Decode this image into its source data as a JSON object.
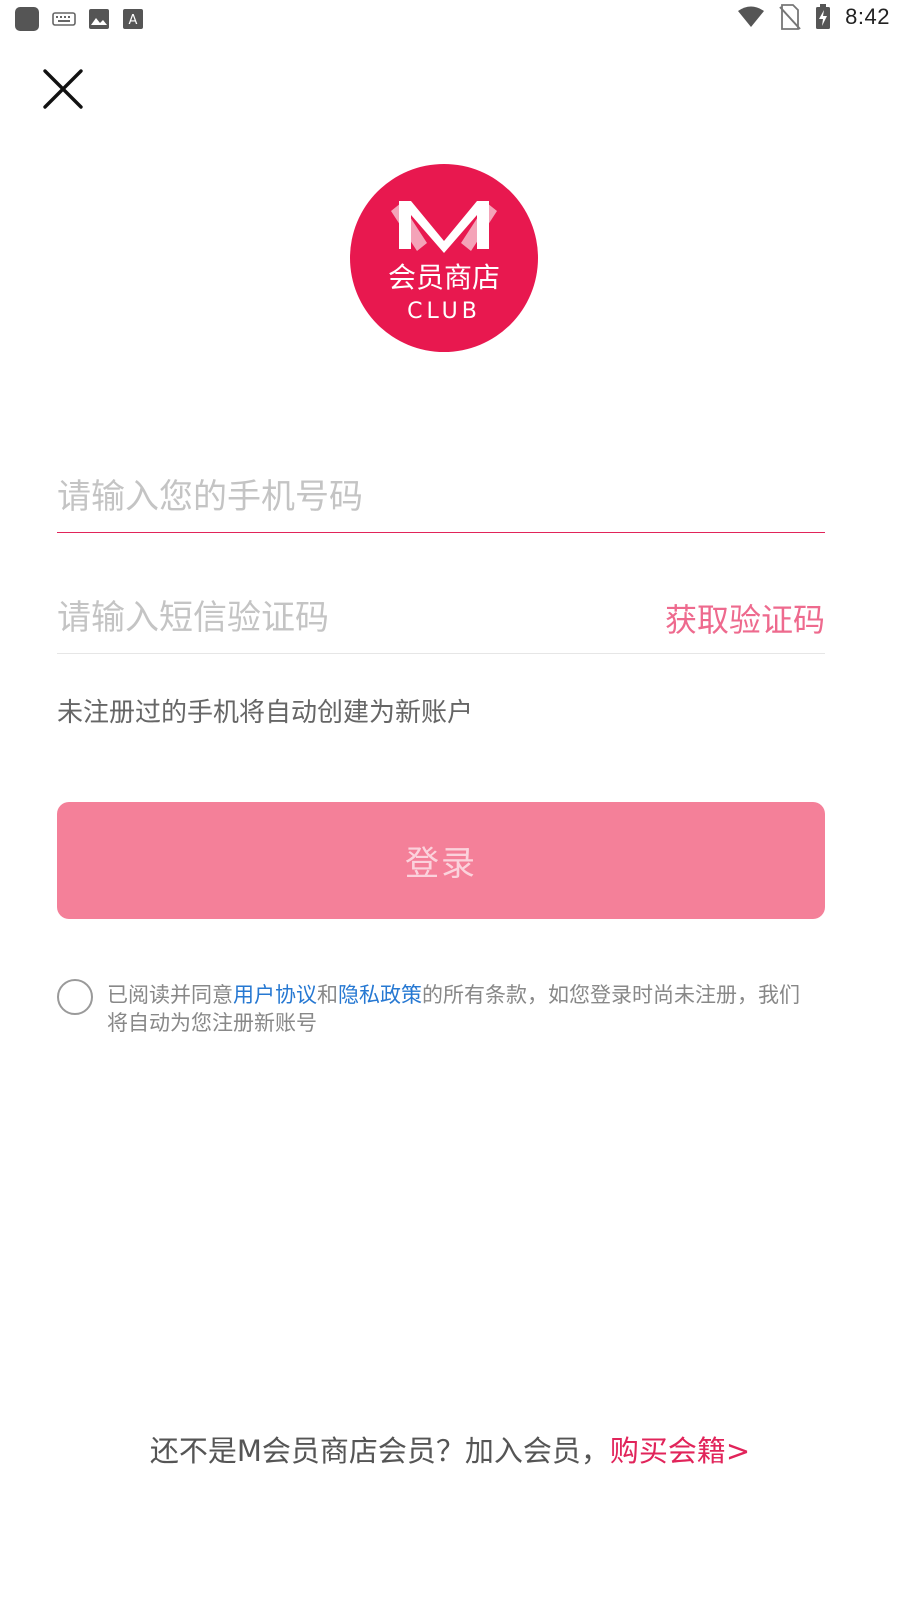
{
  "status_bar": {
    "time": "8:42",
    "left_icons": [
      "app-square-icon",
      "keyboard-icon",
      "image-icon",
      "font-a-icon"
    ],
    "right_icons": [
      "wifi-icon",
      "no-sim-icon",
      "battery-charging-icon"
    ]
  },
  "header": {
    "close_icon": "close-icon"
  },
  "logo": {
    "line1": "会员商店",
    "line2": "CLUB",
    "color": "#e8184f"
  },
  "form": {
    "phone_placeholder": "请输入您的手机号码",
    "phone_value": "",
    "code_placeholder": "请输入短信验证码",
    "code_value": "",
    "get_code_label": "获取验证码",
    "hint": "未注册过的手机将自动创建为新账户",
    "login_label": "登录"
  },
  "agreement": {
    "prefix": "已阅读并同意",
    "user_agreement": "用户协议",
    "and": "和",
    "privacy_policy": "隐私政策",
    "suffix": "的所有条款，如您登录时尚未注册，我们将自动为您注册新账号",
    "checked": false
  },
  "footer": {
    "text": "还不是M会员商店会员？加入会员，",
    "link": "购买会籍>"
  },
  "colors": {
    "accent": "#e1245a",
    "login_button": "#f48099",
    "link_blue": "#2678d2"
  }
}
